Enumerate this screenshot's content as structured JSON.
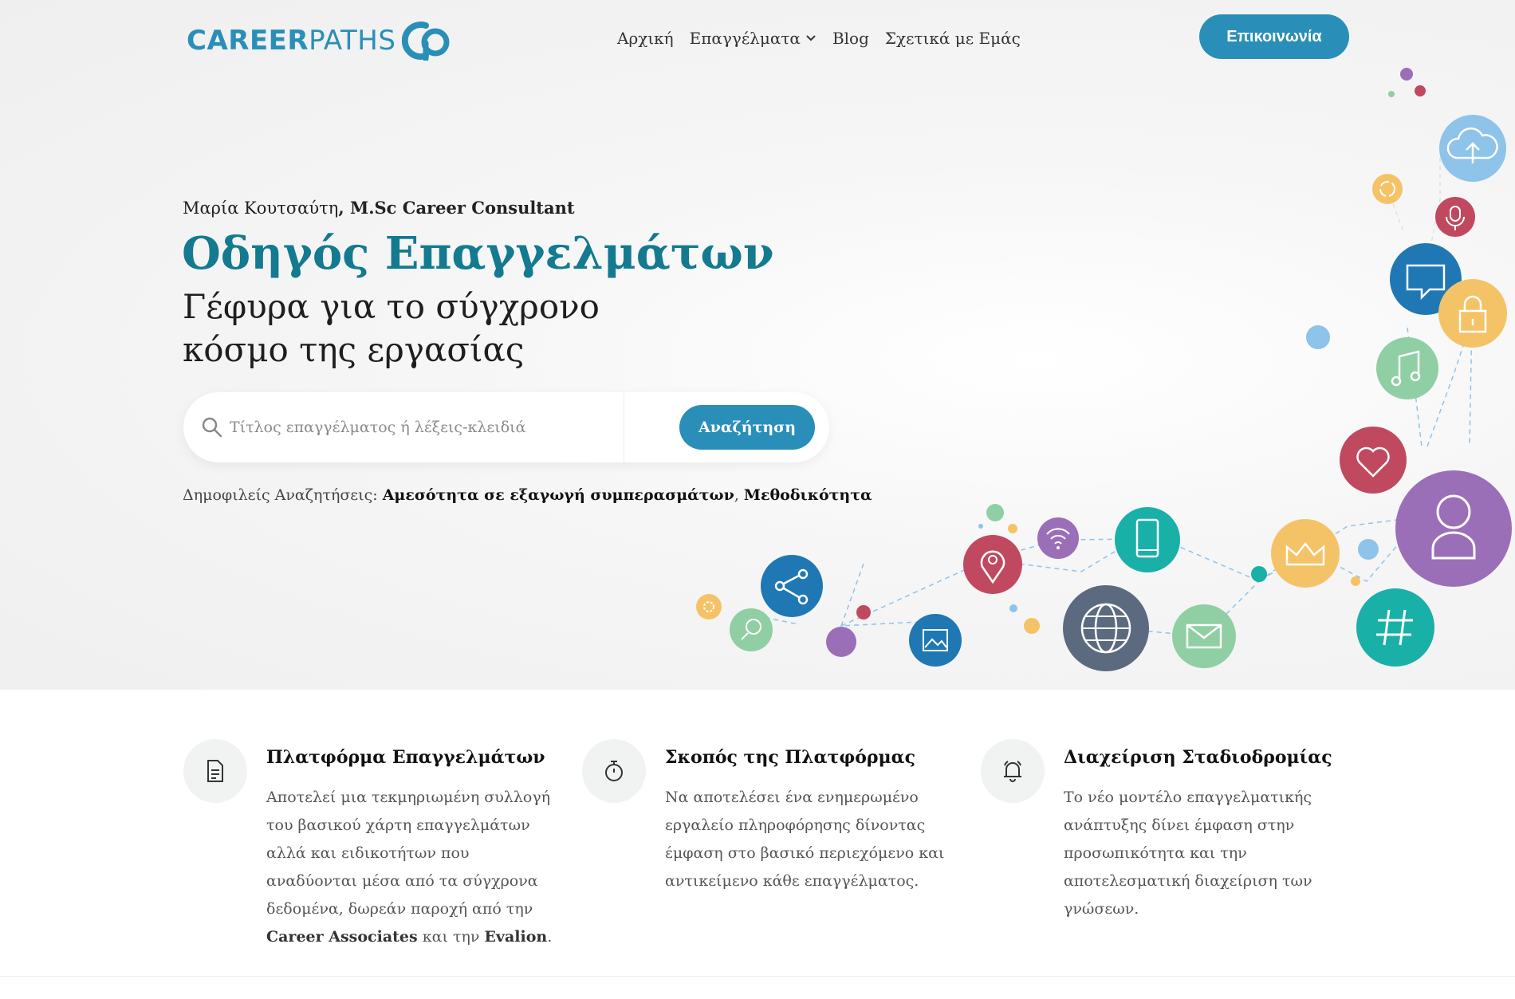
{
  "logo": {
    "part1": "CAREER",
    "part2": "PATHS",
    "mark_color": "#2a8fb8"
  },
  "nav": {
    "home": "Αρχική",
    "professions": "Επαγγέλματα",
    "blog": "Blog",
    "about": "Σχετικά με Εμάς"
  },
  "header": {
    "contact_label": "Επικοινωνία"
  },
  "hero": {
    "author_name": "Μαρία Κουτσαύτη",
    "author_role": ", M.Sc Career Consultant",
    "title": "Οδηγός Επαγγελμάτων",
    "subtitle_line1": "Γέφυρα για το σύγχρονο",
    "subtitle_line2": "κόσμο της εργασίας"
  },
  "search": {
    "placeholder": "Τίτλος επαγγέλματος ή λέξεις-κλειδιά",
    "button_label": "Αναζήτηση"
  },
  "popular": {
    "label": "Δημοφιλείς Αναζητήσεις: ",
    "items": [
      "Αμεσότητα σε εξαγωγή συμπερασμάτων",
      "Μεθοδικότητα"
    ],
    "separator": ", "
  },
  "features": [
    {
      "icon": "document-icon",
      "title": "Πλατφόρμα Επαγγελμάτων",
      "text_before": "Αποτελεί μια τεκμηριωμένη συλλογή του βασικού χάρτη επαγγελμάτων αλλά και ειδικοτήτων που αναδύονται μέσα από τα σύγχρονα δεδομένα, δωρεάν παροχή από την ",
      "bold1": "Career Associates",
      "text_mid": " και την ",
      "bold2": "Evalion",
      "text_end": "."
    },
    {
      "icon": "stopwatch-icon",
      "title": "Σκοπός της Πλατφόρμας",
      "text": "Να αποτελέσει ένα ενημερωμένο εργαλείο πληροφόρησης δίνοντας έμφαση στο βασικό περιεχόμενο και αντικείμενο κάθε επαγγέλματος."
    },
    {
      "icon": "bell-icon",
      "title": "Διαχείριση Σταδιοδρομίας",
      "text": "Το νέο μοντέλο επαγγελματικής ανάπτυξης δίνει έμφαση στην προσωπικότητα και την αποτελεσματική διαχείριση των γνώσεων."
    }
  ],
  "colors": {
    "brand_blue": "#2a8fb8",
    "title_teal": "#137a90",
    "purple": "#9b6fb8",
    "dark_blue": "#1f78b4",
    "yellow": "#f5c367",
    "red": "#c1495f",
    "green": "#8fcfa3",
    "teal": "#19b0a8",
    "slate": "#5c6a80",
    "light_blue": "#8ec3ea"
  }
}
